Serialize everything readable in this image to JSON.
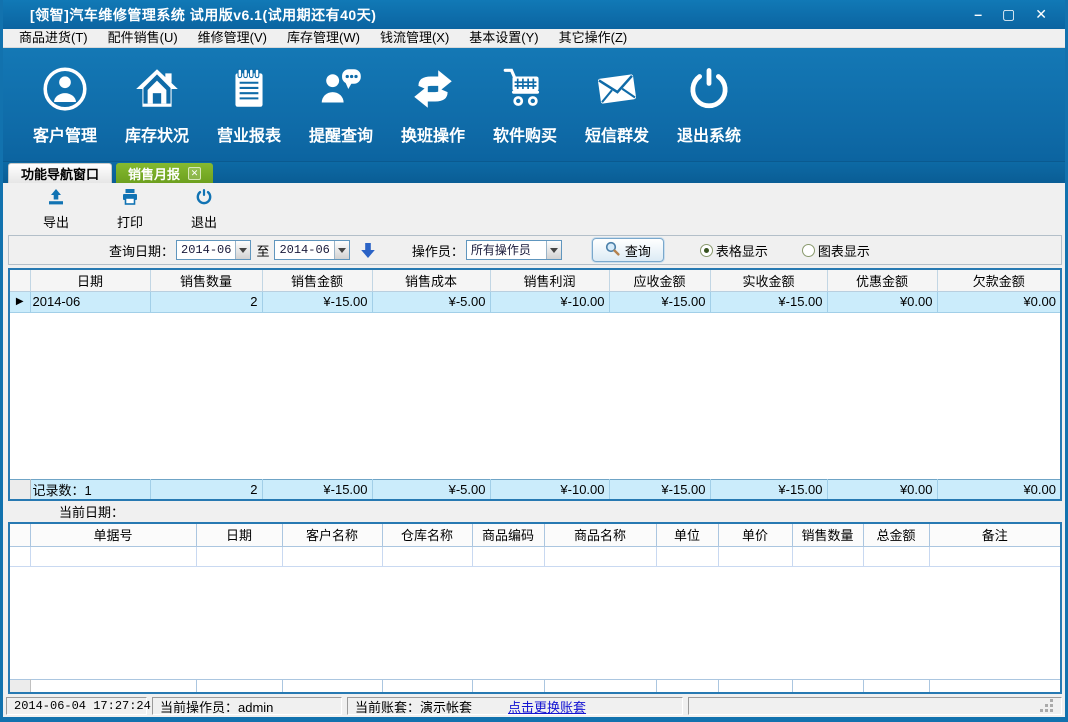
{
  "window": {
    "title": "[领智]汽车维修管理系统  试用版v6.1(试用期还有40天)",
    "controls": {
      "minimize": "–",
      "maximize": "▢",
      "close": "✕"
    }
  },
  "menu": {
    "items": [
      {
        "label": "商品进货(T)"
      },
      {
        "label": "配件销售(U)"
      },
      {
        "label": "维修管理(V)"
      },
      {
        "label": "库存管理(W)"
      },
      {
        "label": "钱流管理(X)"
      },
      {
        "label": "基本设置(Y)"
      },
      {
        "label": "其它操作(Z)"
      }
    ]
  },
  "toolbar": {
    "items": [
      {
        "label": "客户管理",
        "icon": "user-circle-icon"
      },
      {
        "label": "库存状况",
        "icon": "home-icon"
      },
      {
        "label": "营业报表",
        "icon": "report-notepad-icon"
      },
      {
        "label": "提醒查询",
        "icon": "person-chat-icon"
      },
      {
        "label": "换班操作",
        "icon": "sync-arrows-icon"
      },
      {
        "label": "软件购买",
        "icon": "shopping-cart-icon"
      },
      {
        "label": "短信群发",
        "icon": "mail-envelope-icon"
      },
      {
        "label": "退出系统",
        "icon": "power-icon"
      }
    ]
  },
  "tabs": [
    {
      "label": "功能导航窗口",
      "active": false
    },
    {
      "label": "销售月报",
      "active": true,
      "close_glyph": "✕"
    }
  ],
  "subtoolbar": {
    "items": [
      {
        "label": "导出",
        "icon": "export-icon"
      },
      {
        "label": "打印",
        "icon": "print-icon"
      },
      {
        "label": "退出",
        "icon": "exit-power-icon"
      }
    ]
  },
  "query": {
    "date_label": "查询日期：",
    "date_from": "2014-06",
    "to_label": "至",
    "date_to": "2014-06",
    "operator_label": "操作员：",
    "operator_value": "所有操作员",
    "search_label": "查询",
    "display_options": [
      {
        "label": "表格显示",
        "selected": true
      },
      {
        "label": "图表显示",
        "selected": false
      }
    ]
  },
  "monthly_table": {
    "row_marker": "▶",
    "columns": [
      "日期",
      "销售数量",
      "销售金额",
      "销售成本",
      "销售利润",
      "应收金额",
      "实收金额",
      "优惠金额",
      "欠款金额"
    ],
    "rows": [
      [
        "2014-06",
        "2",
        "¥-15.00",
        "¥-5.00",
        "¥-10.00",
        "¥-15.00",
        "¥-15.00",
        "¥0.00",
        "¥0.00"
      ]
    ],
    "summary": [
      "记录数：1",
      "2",
      "¥-15.00",
      "¥-5.00",
      "¥-10.00",
      "¥-15.00",
      "¥-15.00",
      "¥0.00",
      "¥0.00"
    ]
  },
  "current_date_label": "当前日期：",
  "detail_table": {
    "columns": [
      "单据号",
      "日期",
      "客户名称",
      "仓库名称",
      "商品编码",
      "商品名称",
      "单位",
      "单价",
      "销售数量",
      "总金额",
      "备注"
    ]
  },
  "status_bar": {
    "datetime": "2014-06-04 17:27:24",
    "operator": "当前操作员：admin",
    "account": "当前账套：演示帐套",
    "switch_link": "点击更换账套"
  },
  "colors": {
    "titlebar_blue": "#0d6ba6",
    "toolbar_blue": "#1176b3",
    "active_tab_green": "#79ad29",
    "accent_icon_blue": "#1173b3",
    "table_border_blue": "#2779b2",
    "row_highlight": "#cbecfb",
    "link_blue": "#1414d2"
  }
}
